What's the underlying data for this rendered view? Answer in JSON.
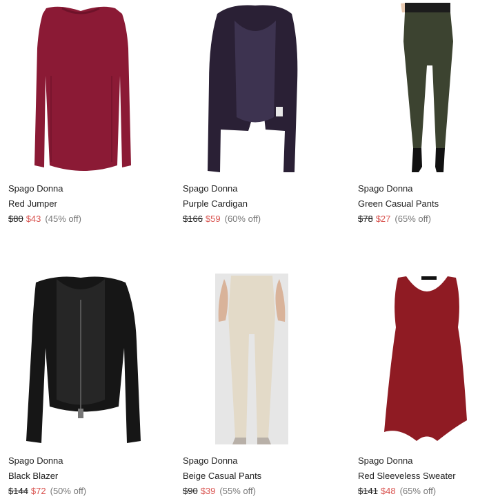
{
  "colors": {
    "sale": "#d9534f",
    "text": "#222222",
    "discount": "#777777"
  },
  "products": [
    {
      "brand": "Spago Donna",
      "name": "Red Jumper",
      "original_price": "$80",
      "sale_price": "$43",
      "discount": "(45% off)",
      "image_icon": "red-jumper-image"
    },
    {
      "brand": "Spago Donna",
      "name": "Purple Cardigan",
      "original_price": "$166",
      "sale_price": "$59",
      "discount": "(60% off)",
      "image_icon": "purple-cardigan-image"
    },
    {
      "brand": "Spago Donna",
      "name": "Green Casual Pants",
      "original_price": "$78",
      "sale_price": "$27",
      "discount": "(65% off)",
      "image_icon": "green-pants-image"
    },
    {
      "brand": "Spago Donna",
      "name": "Black Blazer",
      "original_price": "$144",
      "sale_price": "$72",
      "discount": "(50% off)",
      "image_icon": "black-blazer-image"
    },
    {
      "brand": "Spago Donna",
      "name": "Beige Casual Pants",
      "original_price": "$90",
      "sale_price": "$39",
      "discount": "(55% off)",
      "image_icon": "beige-pants-image"
    },
    {
      "brand": "Spago Donna",
      "name": "Red Sleeveless Sweater",
      "original_price": "$141",
      "sale_price": "$48",
      "discount": "(65% off)",
      "image_icon": "red-sleeveless-image"
    }
  ]
}
